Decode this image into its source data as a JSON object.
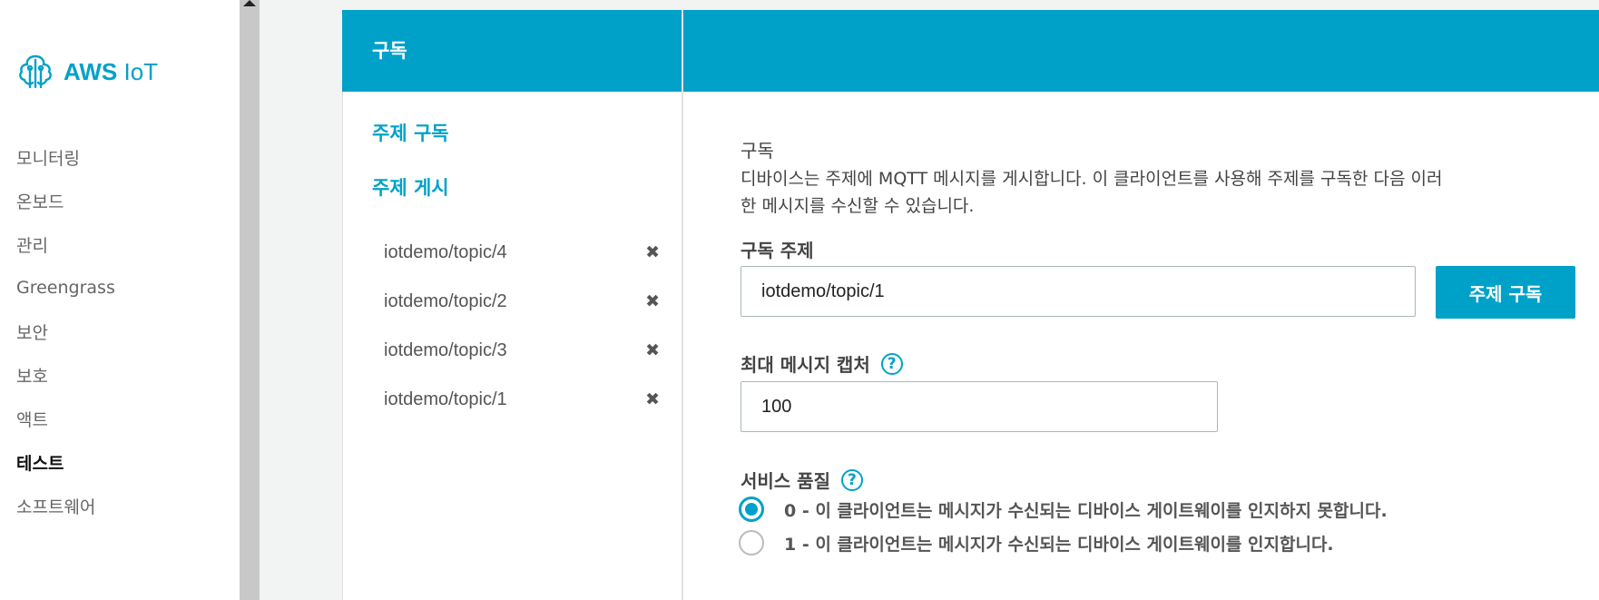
{
  "app": {
    "logo_text_bold": "AWS",
    "logo_text_light": "IoT",
    "logo_icon": "aws-iot-icon"
  },
  "sidebar": {
    "items": [
      {
        "label": "모니터링"
      },
      {
        "label": "온보드"
      },
      {
        "label": "관리"
      },
      {
        "label": "Greengrass"
      },
      {
        "label": "보안"
      },
      {
        "label": "보호"
      },
      {
        "label": "액트"
      },
      {
        "label": "테스트",
        "active": true
      },
      {
        "label": "소프트웨어"
      }
    ]
  },
  "panel": {
    "title": "구독",
    "links": {
      "subscribe": "주제 구독",
      "publish": "주제 게시"
    },
    "topics": [
      {
        "name": "iotdemo/topic/4"
      },
      {
        "name": "iotdemo/topic/2"
      },
      {
        "name": "iotdemo/topic/3"
      },
      {
        "name": "iotdemo/topic/1"
      }
    ],
    "close_glyph": "✖"
  },
  "form": {
    "section_title": "구독",
    "section_desc_line1": "디바이스는 주제에 MQTT 메시지를 게시합니다. 이 클라이언트를 사용해 주제를 구독한 다음 이러",
    "section_desc_line2": "한 메시지를 수신할 수 있습니다.",
    "topic_label": "구독 주제",
    "topic_value": "iotdemo/topic/1",
    "subscribe_button": "주제 구독",
    "max_capture_label": "최대 메시지 캡처",
    "max_capture_value": "100",
    "qos_label": "서비스 품질",
    "help_glyph": "?",
    "qos_options": [
      {
        "label": "0 - 이 클라이언트는 메시지가 수신되는 디바이스 게이트웨이를 인지하지 못합니다.",
        "selected": true
      },
      {
        "label": "1 - 이 클라이언트는 메시지가 수신되는 디바이스 게이트웨이를 인지합니다.",
        "selected": false
      }
    ]
  },
  "colors": {
    "accent": "#00a1c9",
    "background": "#f2f3f3",
    "scrollbar": "#c8c8c8"
  }
}
